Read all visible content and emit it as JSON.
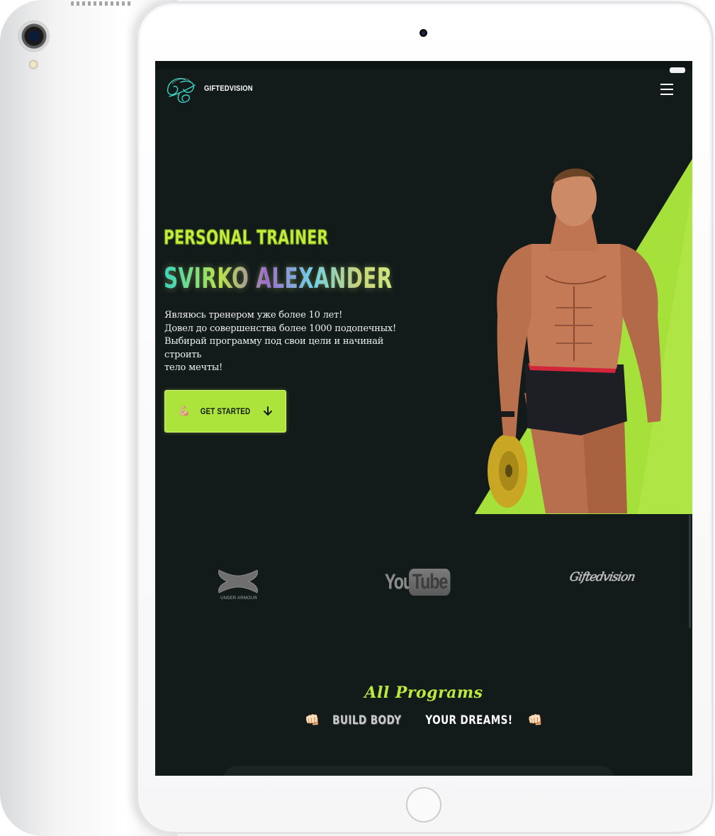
{
  "brand": {
    "name": "GIFTEDVISION",
    "accent": "#ace43c",
    "background": "#131a1a"
  },
  "header": {
    "menu_icon": "hamburger-menu-icon"
  },
  "hero": {
    "subtitle": "PERSONAL TRAINER",
    "title": "SVIRKO ALEXANDER",
    "bio_lines": [
      "Являюсь тренером уже более 10 лет!",
      "Довел до совершенства более 1000 подопечных!",
      "Выбирай программу под свои цели и начинай строить",
      "тело мечты!"
    ],
    "cta": {
      "emoji": "💪🏼",
      "label": "GET STARTED",
      "icon": "arrow-down-icon"
    },
    "image": "bodybuilder-photo"
  },
  "partners": {
    "under_armour": {
      "caption": "UNDER ARMOUR"
    },
    "youtube": {
      "you": "You",
      "tube": "Tube"
    },
    "giftedvision": {
      "text": "Giftedvision"
    }
  },
  "programs": {
    "title": "All Programs",
    "subtitle_left": "BUILD BODY",
    "subtitle_right": "YOUR DREAMS!",
    "emoji": "👊🏻"
  }
}
